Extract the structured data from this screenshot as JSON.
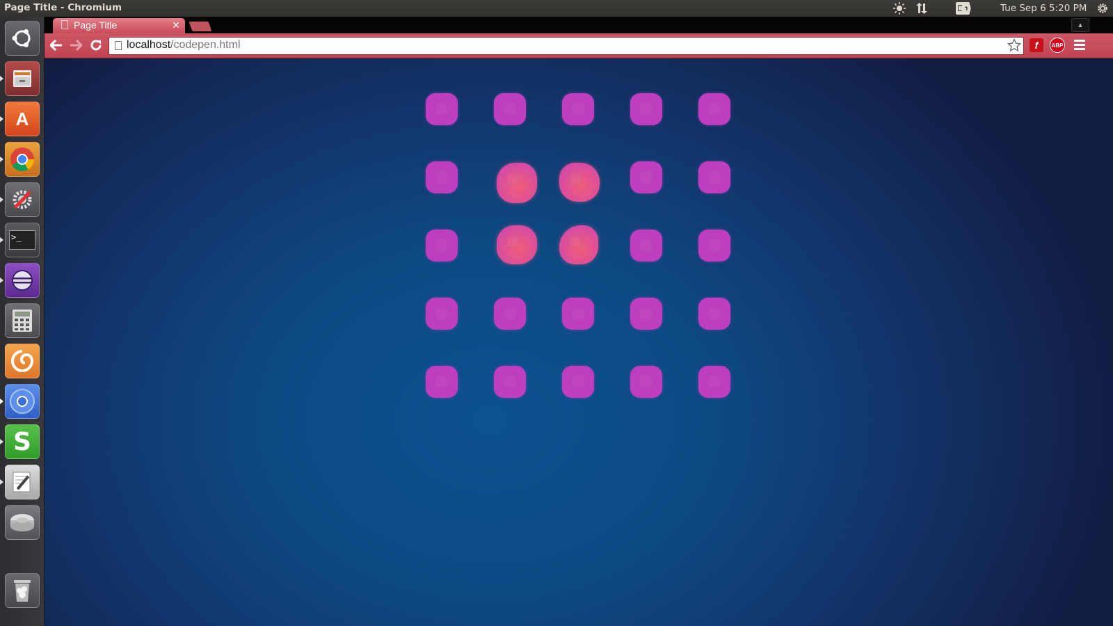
{
  "panel": {
    "window_title": "Page Title - Chromium",
    "keyboard_layout": "En",
    "clock": "Tue Sep  6  5:20 PM",
    "icons": [
      "brightness-icon",
      "network-icon",
      "volume-icon",
      "settings-gear-icon"
    ]
  },
  "launcher": {
    "items": [
      {
        "name": "ubuntu-dash",
        "icon": "ubuntu-logo-icon"
      },
      {
        "name": "files",
        "icon": "file-cabinet-icon",
        "running": true
      },
      {
        "name": "ubuntu-software-center",
        "icon": "shopping-bag-icon",
        "running": true
      },
      {
        "name": "google-chrome",
        "icon": "chrome-icon",
        "running": true
      },
      {
        "name": "system-settings",
        "icon": "wrench-gear-icon",
        "running": true
      },
      {
        "name": "terminal",
        "icon": "terminal-icon",
        "running": true
      },
      {
        "name": "eclipse",
        "icon": "eclipse-icon",
        "running": true
      },
      {
        "name": "calculator",
        "icon": "calculator-icon"
      },
      {
        "name": "meld",
        "icon": "meld-swirl-icon"
      },
      {
        "name": "chromium",
        "icon": "chromium-icon",
        "running": true,
        "focused": true
      },
      {
        "name": "sublime-s-app",
        "icon": "green-s-icon",
        "running": true
      },
      {
        "name": "text-editor",
        "icon": "text-editor-icon",
        "running": true
      },
      {
        "name": "disk-drive",
        "icon": "hard-drive-icon"
      },
      {
        "name": "trash",
        "icon": "trash-icon"
      }
    ]
  },
  "browser": {
    "tab_title": "Page Title",
    "url_host": "localhost",
    "url_path": "/codepen.html",
    "extensions": {
      "flash_label": "f",
      "adblock_label": "ABP"
    },
    "colors": {
      "frame": "#c64855",
      "tab": "#e37d86"
    }
  },
  "content": {
    "grid": {
      "rows": 5,
      "cols": 5
    },
    "blob_color": "#be3fbd",
    "hot_blob_color": "#ef5e79",
    "hot_cells": [
      [
        1,
        1
      ],
      [
        1,
        2
      ],
      [
        2,
        1
      ],
      [
        2,
        2
      ]
    ],
    "background_colors": [
      "#121d44",
      "#0c5290"
    ]
  }
}
